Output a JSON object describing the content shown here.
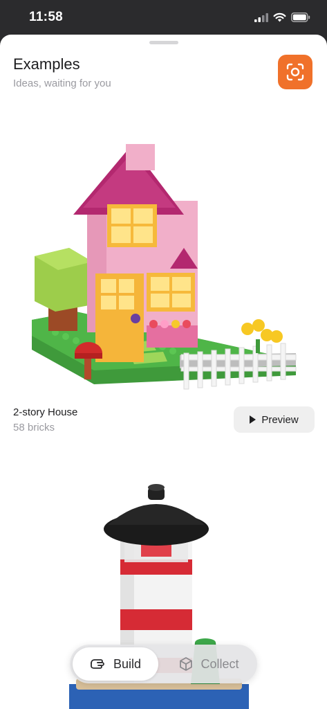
{
  "status_bar": {
    "time": "11:58",
    "icons": [
      "cellular-signal-icon",
      "wifi-icon",
      "battery-icon"
    ]
  },
  "header": {
    "title": "Examples",
    "subtitle": "Ideas, waiting for you",
    "scan_icon": "camera-scan-icon"
  },
  "examples": [
    {
      "name": "2-story House",
      "bricks": "58 bricks",
      "preview_label": "Preview",
      "image": "lego-house-image"
    },
    {
      "image": "lego-lighthouse-image"
    }
  ],
  "tabs": [
    {
      "label": "Build",
      "icon": "build-hand-icon",
      "selected": true
    },
    {
      "label": "Collect",
      "icon": "cube-icon",
      "selected": false
    }
  ],
  "colors": {
    "accent": "#f0712a",
    "status_bar_bg": "#2b2b2d",
    "secondary_text": "#9a9aa0"
  }
}
